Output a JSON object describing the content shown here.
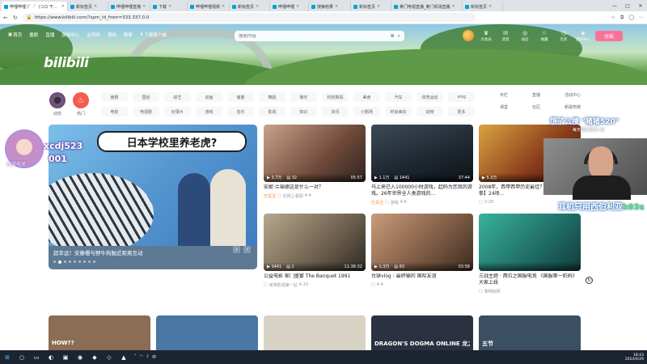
{
  "browser": {
    "tabs": [
      {
        "title": "哔哩哔哩 (゜-゜)つロ 干杯~",
        "active": true
      },
      {
        "title": "新标签页",
        "active": false
      },
      {
        "title": "哔哩哔哩直播",
        "active": false
      },
      {
        "title": "下载",
        "active": false
      },
      {
        "title": "哔哩哔哩视频",
        "active": false
      },
      {
        "title": "新标签页",
        "active": false
      },
      {
        "title": "哔哩哔哩",
        "active": false
      },
      {
        "title": "搜索结果",
        "active": false
      },
      {
        "title": "新标签页",
        "active": false
      },
      {
        "title": "奥门电视直播_奥门现场直播",
        "active": false
      },
      {
        "title": "新标签页",
        "active": false
      }
    ],
    "url": "https://www.bilibili.com/?spm_id_from=333.337.0.0",
    "window_controls": {
      "minimize": "—",
      "maximize": "□",
      "close": "✕"
    }
  },
  "header": {
    "logo": "bilibili",
    "nav": [
      {
        "label": "首页",
        "icon": "tv-icon"
      },
      {
        "label": "番剧"
      },
      {
        "label": "直播"
      },
      {
        "label": "游戏中心"
      },
      {
        "label": "会员购"
      },
      {
        "label": "漫画"
      },
      {
        "label": "赛事"
      },
      {
        "label": "下载客户端",
        "icon": "download-icon"
      }
    ],
    "search_placeholder": "搜索内容",
    "right_nav": [
      {
        "label": "大会员",
        "glyph": "♛"
      },
      {
        "label": "消息",
        "glyph": "✉"
      },
      {
        "label": "动态",
        "glyph": "◎"
      },
      {
        "label": "收藏",
        "glyph": "☆"
      },
      {
        "label": "历史",
        "glyph": "◷"
      },
      {
        "label": "创作中心",
        "glyph": "◈"
      }
    ],
    "upload_label": "投稿"
  },
  "channels": {
    "dynamic_label": "动态",
    "hot_label": "热门",
    "chips": [
      "番剧",
      "国创",
      "综艺",
      "动画",
      "鬼畜",
      "舞蹈",
      "娱乐",
      "科技数码",
      "美食",
      "汽车",
      "体育运动",
      "vlog",
      "电影",
      "电视剧",
      "纪录片",
      "游戏",
      "音乐",
      "影视",
      "知识",
      "资讯",
      "小剧场",
      "时尚美妆",
      "动物",
      "更多"
    ],
    "right_links": [
      "专栏",
      "直播",
      "活动中心",
      "课堂",
      "社区",
      "新歌热榜"
    ]
  },
  "carousel": {
    "headline": "日本学校里养老虎?",
    "caption": "超幸运！安藤樱与野牛狗触近距离互动",
    "slide_count": 9,
    "active_slide": 1,
    "prev": "‹",
    "next": "›"
  },
  "videos": [
    {
      "title": "安妮·兰福德这是什么一对？",
      "up": "在网上看剧",
      "date": "4-4",
      "views": "3.7万",
      "danmaku": "32",
      "duration": "05:57",
      "tag": "已关注"
    },
    {
      "title": "马上来已入100000小时游戏，起码为您我的游戏。26年世界全人类游戏的…",
      "up": "游戏",
      "date": "4-6",
      "views": "1.1万",
      "danmaku": "1441",
      "duration": "37:44",
      "tag": "已关注"
    },
    {
      "title": "2008年，西甲西甲历史最佳？24场【中场铁拳】24场…",
      "up": "",
      "date": "3-28",
      "views": "5.3万",
      "danmaku": "",
      "duration": "",
      "tag": ""
    },
    {
      "title": "公益电影 家门盛宴 The Banquet 1991",
      "up": "家族影视第一站",
      "date": "4-10",
      "views": "1441",
      "danmaku": "2",
      "duration": "11:36:32",
      "tag": ""
    },
    {
      "title": "台球vlog｜最终输的 国际友谊",
      "up": "",
      "date": "4-4",
      "views": "1.3万",
      "danmaku": "83",
      "duration": "03:58",
      "tag": ""
    },
    {
      "title": "三战主题 · 两位之国服电竞 《国服第一奶妈》大家上线",
      "up": "黎明快照",
      "date": "",
      "views": "",
      "danmaku": "",
      "duration": "",
      "tag": ""
    }
  ],
  "row3": [
    "HOW??",
    "",
    "",
    "",
    "DRAGON'S DOGMA ONLINE 龙之信条Online",
    "五节"
  ],
  "overlays": {
    "left_name": "xcdj523",
    "left_number": "001",
    "left_sub": "西游电竞",
    "right_search": "饿了么搜 \"猪猪520\"",
    "right_sub": "每天领红包35-10",
    "right_bottom": "耳机只用西伯利亚",
    "right_bottom_tag": "k03s"
  },
  "taskbar": {
    "time": "18:43",
    "date": "2024/4/29",
    "lang": "中"
  }
}
